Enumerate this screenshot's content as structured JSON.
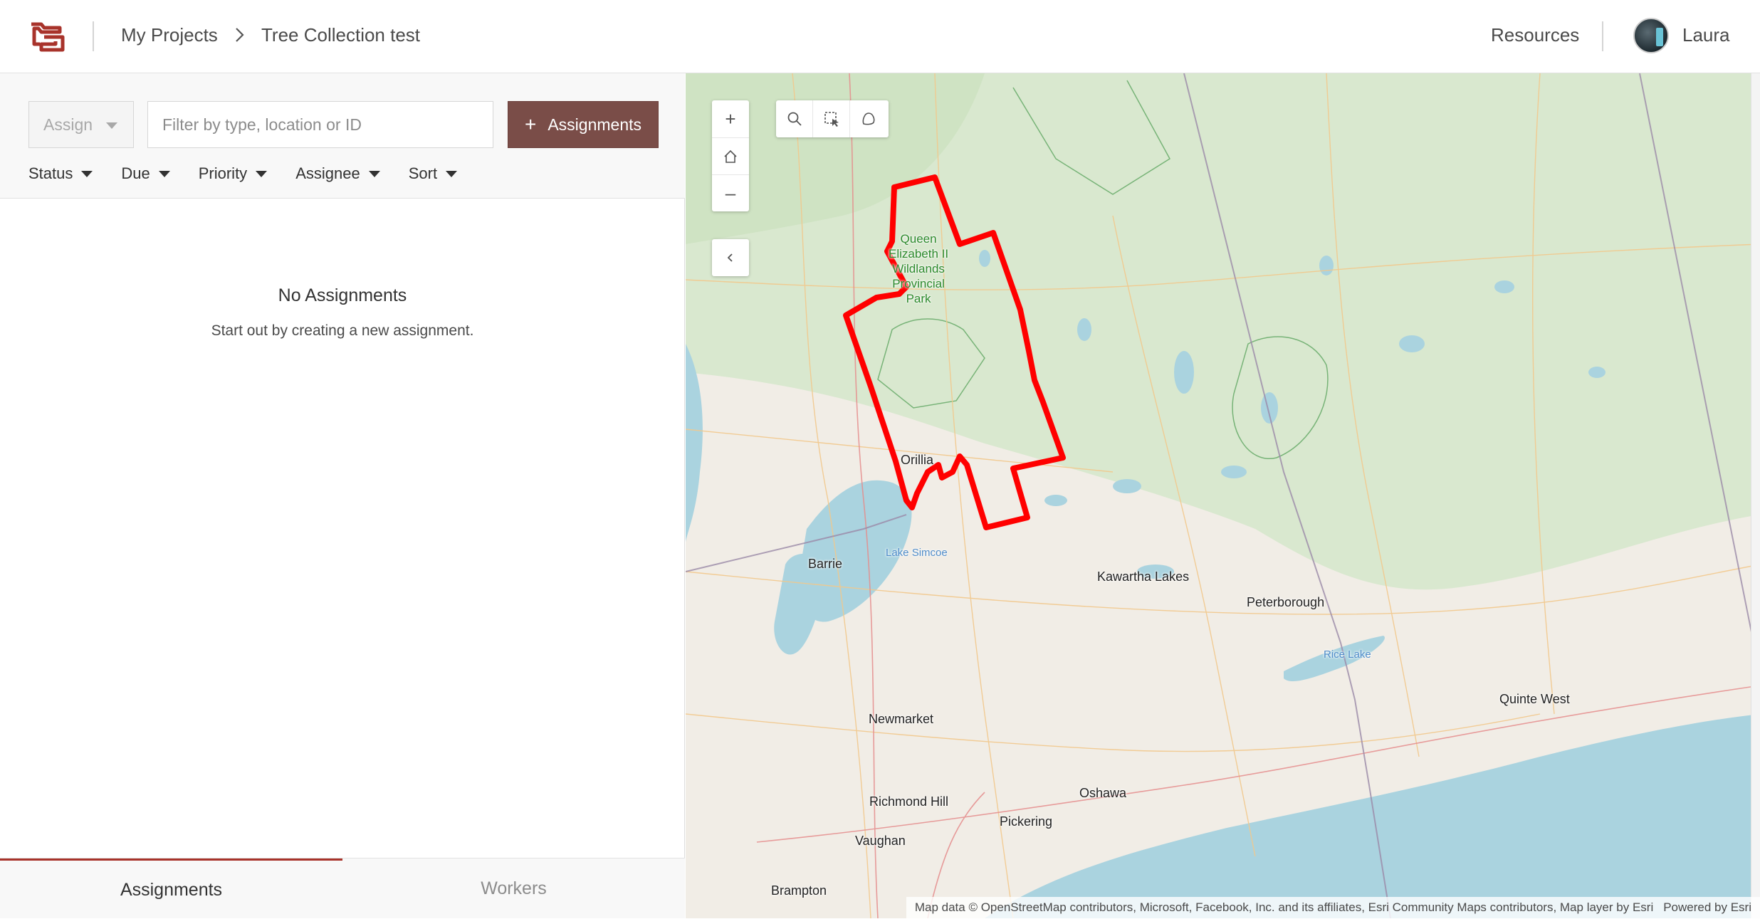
{
  "header": {
    "breadcrumb": [
      "My Projects",
      "Tree Collection test"
    ],
    "resources_label": "Resources",
    "user_name": "Laura"
  },
  "panel": {
    "assign_label": "Assign",
    "filter_placeholder": "Filter by type, location or ID",
    "add_button_label": "Assignments",
    "sort_options": [
      "Status",
      "Due",
      "Priority",
      "Assignee",
      "Sort"
    ],
    "empty_title": "No Assignments",
    "empty_subtitle": "Start out by creating a new assignment.",
    "tabs": [
      {
        "label": "Assignments",
        "active": true
      },
      {
        "label": "Workers",
        "active": false
      }
    ]
  },
  "map": {
    "labels": {
      "orillia": "Orillia",
      "barrie": "Barrie",
      "lake_simcoe": "Lake Simcoe",
      "kawartha_lakes": "Kawartha Lakes",
      "peterborough": "Peterborough",
      "rice_lake": "Rice Lake",
      "quinte_west": "Quinte West",
      "newmarket": "Newmarket",
      "richmond_hill": "Richmond Hill",
      "vaughan": "Vaughan",
      "oshawa": "Oshawa",
      "pickering": "Pickering",
      "brampton": "Brampton",
      "park": "Queen Elizabeth II Wildlands Provincial Park"
    },
    "boundary_color": "#ff0000",
    "attribution": "Map data © OpenStreetMap contributors, Microsoft, Facebook, Inc. and its affiliates, Esri Community Maps contributors, Map layer by Esri",
    "powered_by": "Powered by Esri",
    "controls": {
      "zoom_in": "+",
      "zoom_out": "–"
    }
  },
  "colors": {
    "accent": "#7a4d48",
    "active_tab": "#a8332b",
    "brand": "#a8332b"
  }
}
